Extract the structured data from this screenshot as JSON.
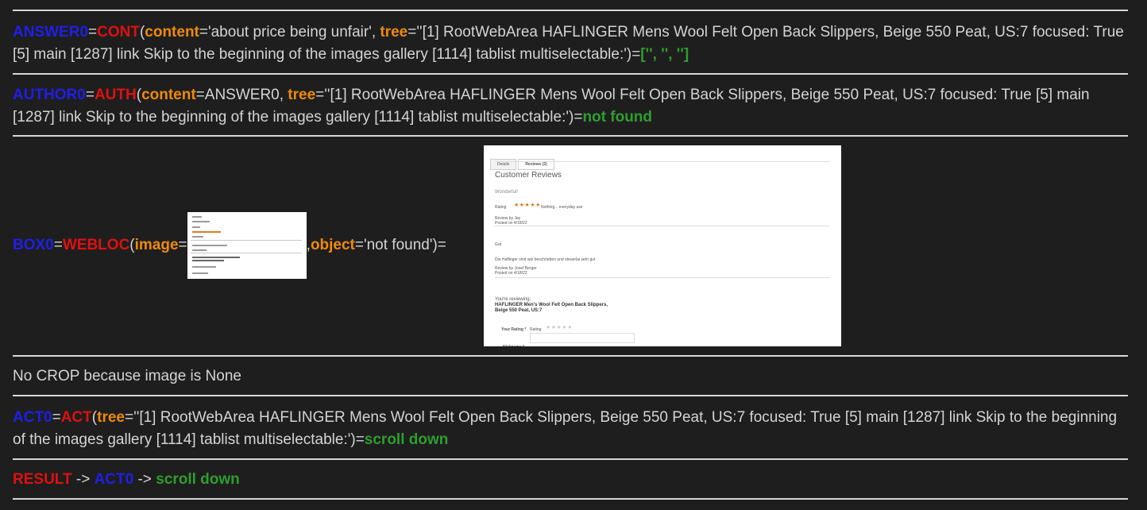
{
  "answer0": {
    "var": "ANSWER0",
    "fn": "CONT",
    "kw_content": "content",
    "content_value": "='about price being unfair', ",
    "kw_tree": "tree",
    "tree_value": "=''[1] RootWebArea HAFLINGER Mens Wool Felt Open Back Slippers, Beige 550 Peat, US:7 focused: True [5] main [1287] link Skip to the beginning of the images gallery [1114] tablist multiselectable:')=",
    "result": "['', '', '']"
  },
  "author0": {
    "var": "AUTHOR0",
    "fn": "AUTH",
    "kw_content": "content",
    "content_value": "=ANSWER0, ",
    "kw_tree": "tree",
    "tree_value": "=''[1] RootWebArea HAFLINGER Mens Wool Felt Open Back Slippers, Beige 550 Peat, US:7 focused: True [5] main [1287] link Skip to the beginning of the images gallery [1114] tablist multiselectable:')=",
    "result": "not found"
  },
  "box0": {
    "var": "BOX0",
    "fn": "WEBLOC",
    "kw_image": "image",
    "kw_object": "object",
    "object_value": "='not found')="
  },
  "review_shot": {
    "tab_details": "Details",
    "tab_reviews": "Reviews (2)",
    "heading": "Customer Reviews",
    "review1_title": "Wonderful!",
    "rating_label": "Rating",
    "stars": "★★★★★",
    "review1_text": "Nothing... everyday use",
    "review1_by": "Review by Jay",
    "review1_date": "Posted on 4/18/22",
    "review2_title": "Gut",
    "review2_text": "Die Haflinger sind wie beschrieben und steuerlai sehr gut",
    "review2_by": "Review by Josef Berger",
    "review2_date": "Posted on 4/18/22",
    "reviewing_label": "You're reviewing:",
    "product_line1": "HAFLINGER Men's Wool Felt Open Back Slippers,",
    "product_line2": "Beige 550 Peat, US:7",
    "your_rating": "Your Rating *",
    "rating_label2": "Rating",
    "empty_stars": "★★★★★",
    "nickname": "Nickname *"
  },
  "crop_note": "No CROP because image is None",
  "act0": {
    "var": "ACT0",
    "fn": "ACT",
    "kw_tree": "tree",
    "tree_value": "=''[1] RootWebArea HAFLINGER Mens Wool Felt Open Back Slippers, Beige 550 Peat, US:7 focused: True [5] main [1287] link Skip to the beginning of the images gallery [1114] tablist multiselectable:')=",
    "result": "scroll down"
  },
  "result_line": {
    "label": "RESULT",
    "arrow1": " -> ",
    "var": "ACT0",
    "arrow2": " -> ",
    "value": "scroll down"
  }
}
